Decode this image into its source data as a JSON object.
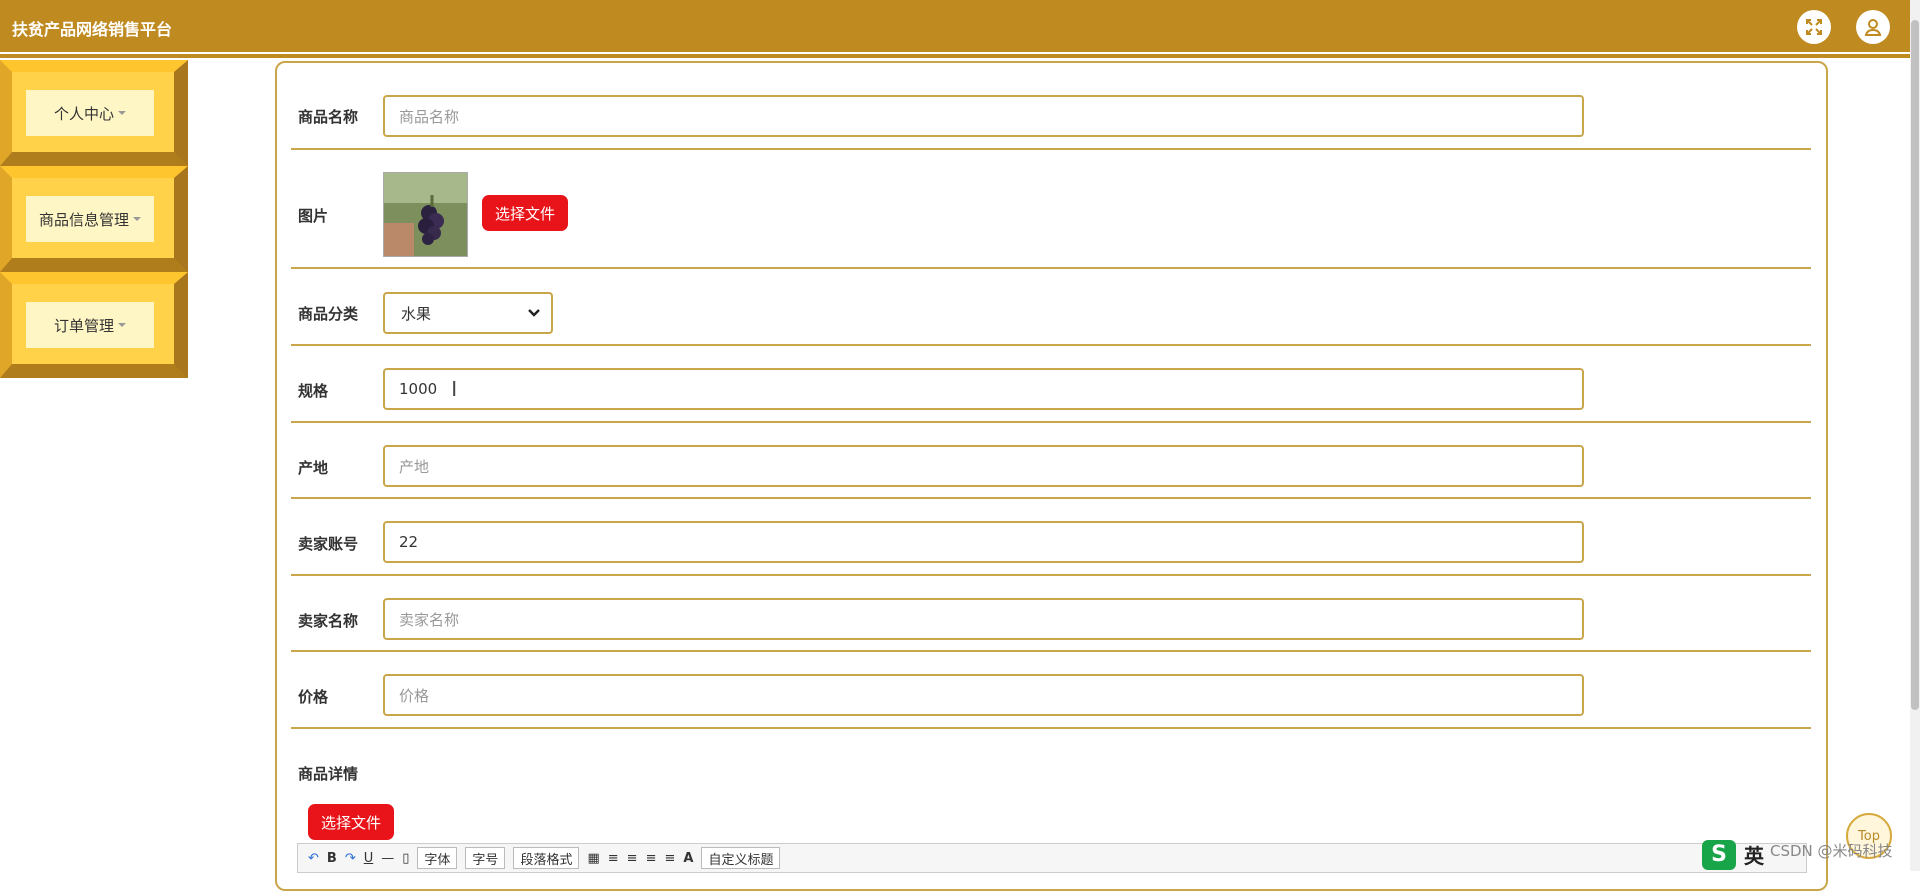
{
  "header": {
    "title": "扶贫产品网络销售平台",
    "icons": [
      "expand-icon",
      "user-icon"
    ]
  },
  "sidebar": {
    "items": [
      {
        "label": "个人中心"
      },
      {
        "label": "商品信息管理"
      },
      {
        "label": "订单管理"
      }
    ]
  },
  "form": {
    "name": {
      "label": "商品名称",
      "placeholder": "商品名称",
      "value": ""
    },
    "image": {
      "label": "图片",
      "button": "选择文件"
    },
    "category": {
      "label": "商品分类",
      "value": "水果"
    },
    "spec": {
      "label": "规格",
      "value": "1000"
    },
    "origin": {
      "label": "产地",
      "placeholder": "产地",
      "value": ""
    },
    "seller_account": {
      "label": "卖家账号",
      "value": "22"
    },
    "seller_name": {
      "label": "卖家名称",
      "placeholder": "卖家名称",
      "value": ""
    },
    "price": {
      "label": "价格",
      "placeholder": "价格",
      "value": ""
    },
    "detail": {
      "label": "商品详情",
      "button": "选择文件"
    }
  },
  "editor": {
    "font": "字体",
    "size": "字号",
    "paragraph": "段落格式",
    "custom": "自定义标题"
  },
  "misc": {
    "top_label": "Top",
    "watermark": "CSDN @米码科技",
    "ime_label": "英"
  },
  "colors": {
    "accent": "#bf8a1f",
    "button_red": "#e8141a"
  }
}
